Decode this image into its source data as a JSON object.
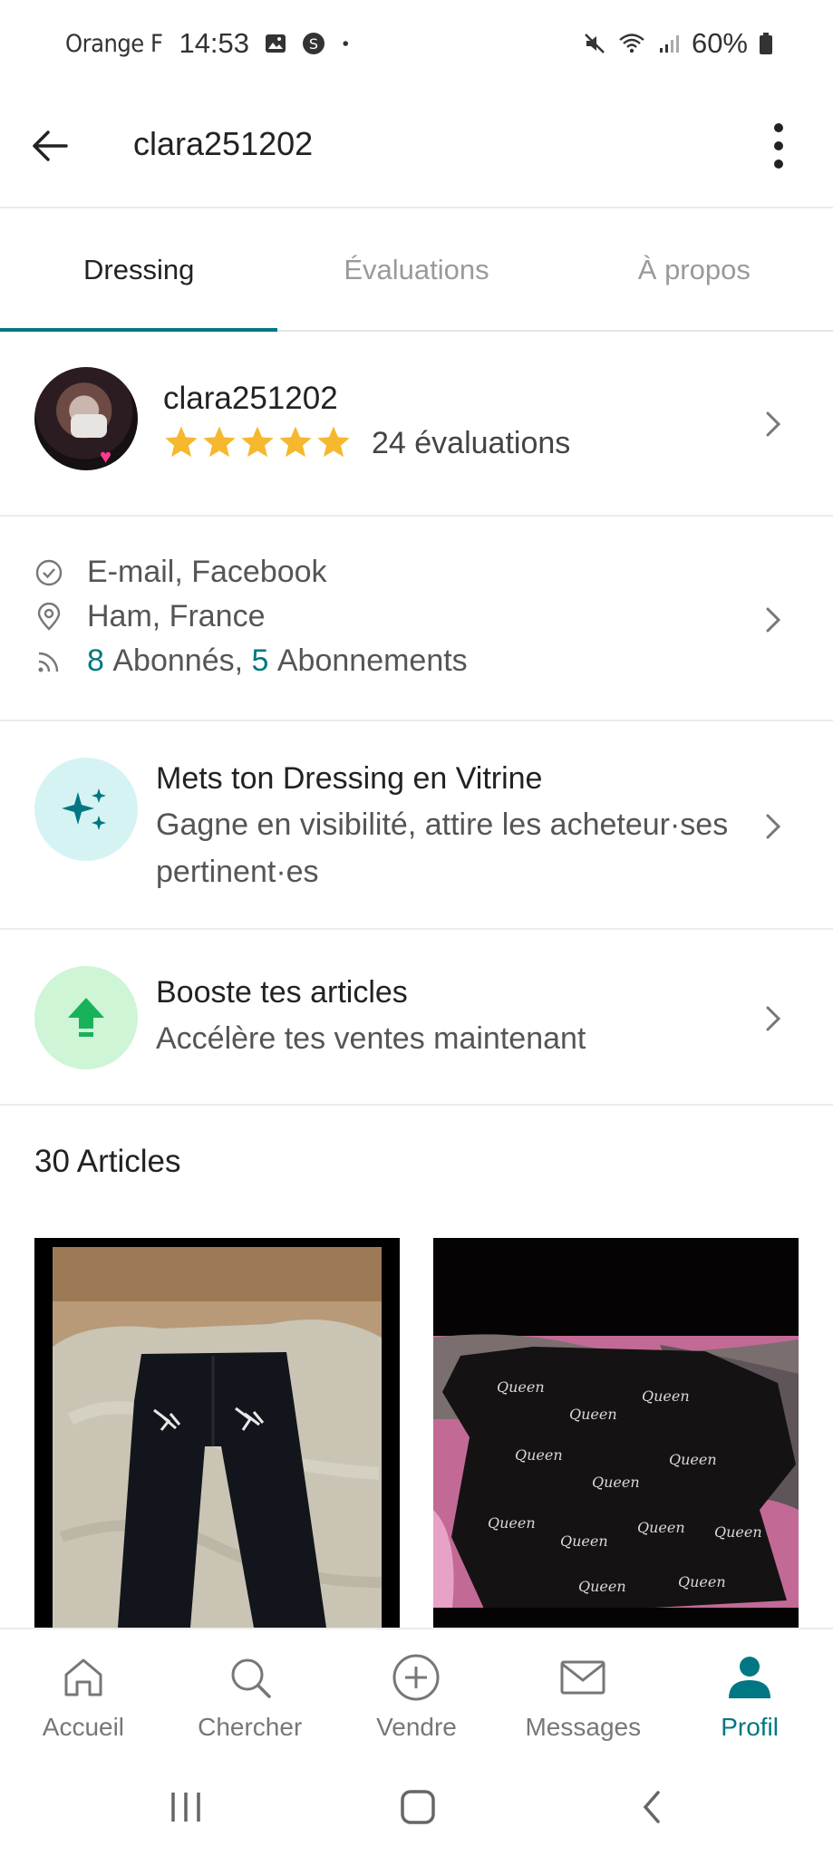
{
  "status_bar": {
    "carrier": "Orange F",
    "time": "14:53",
    "battery": "60%"
  },
  "appbar": {
    "title": "clara251202"
  },
  "tabs": [
    {
      "label": "Dressing",
      "active": true
    },
    {
      "label": "Évaluations",
      "active": false
    },
    {
      "label": "À propos",
      "active": false
    }
  ],
  "profile": {
    "username": "clara251202",
    "stars": 5,
    "rating_text": "24 évaluations",
    "star_color": "#F5B82E"
  },
  "info": {
    "verified": "E-mail, Facebook",
    "location": "Ham, France",
    "followers_count": "8",
    "followers_label": "Abonnés,",
    "following_count": "5",
    "following_label": "Abonnements"
  },
  "promos": [
    {
      "title": "Mets ton Dressing en Vitrine",
      "subtitle": "Gagne en visibilité, attire les acheteur·ses pertinent·es",
      "icon": "sparkles-icon",
      "bg_color": "#D6F3F4"
    },
    {
      "title": "Booste tes articles",
      "subtitle": "Accélère tes ventes maintenant",
      "icon": "boost-arrow-icon",
      "bg_color": "#CDF5D6"
    }
  ],
  "articles": {
    "title": "30 Articles",
    "items": [
      {
        "name": "black jeans with skeleton hands"
      },
      {
        "name": "black t-shirt with Queen print"
      }
    ]
  },
  "bottom_nav": [
    {
      "label": "Accueil",
      "icon": "home-icon",
      "active": false
    },
    {
      "label": "Chercher",
      "icon": "search-icon",
      "active": false
    },
    {
      "label": "Vendre",
      "icon": "plus-circle-icon",
      "active": false
    },
    {
      "label": "Messages",
      "icon": "mail-icon",
      "active": false
    },
    {
      "label": "Profil",
      "icon": "person-icon",
      "active": true
    }
  ],
  "colors": {
    "accent": "#007782"
  }
}
